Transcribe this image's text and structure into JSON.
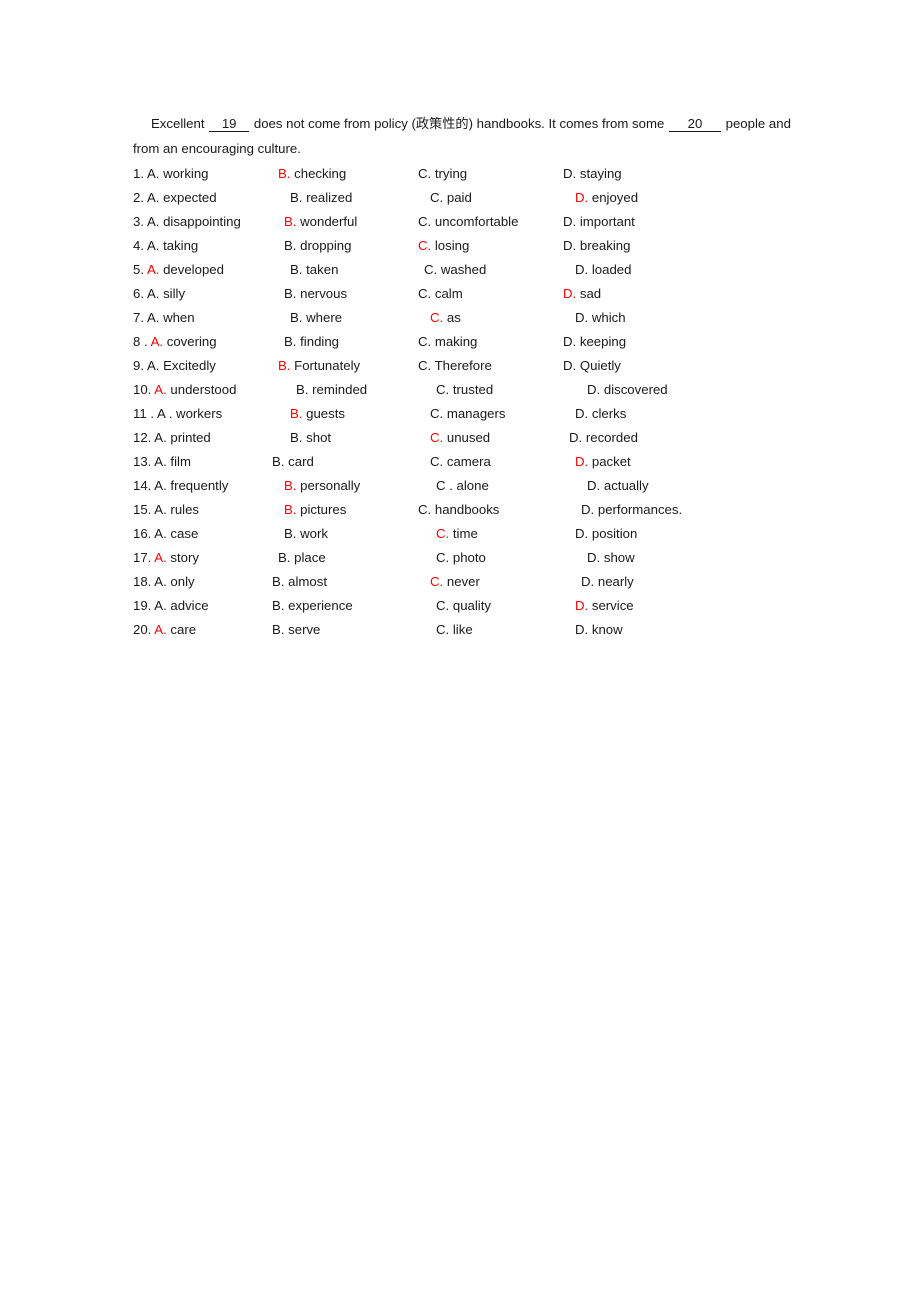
{
  "document": {
    "intro": {
      "line1_pre": "Excellent",
      "blank1": "19",
      "line1_mid": "does not come from policy (",
      "cjk_gloss": "政策性的",
      "line1_mid2": ") handbooks. It comes from some",
      "blank2": "20",
      "line1_post": "people and",
      "line2": "from an encouraging culture."
    },
    "colors": {
      "answer_red": "#FF0000",
      "text_black": "#1a1a1a",
      "page_background": "#ffffff"
    },
    "rows": [
      {
        "number": "1.",
        "options": [
          {
            "label": "A.",
            "text": "working",
            "red": false,
            "shift": "0"
          },
          {
            "label": "B.",
            "text": "checking",
            "red": true,
            "shift": "0"
          },
          {
            "label": "C.",
            "text": "trying",
            "red": false,
            "shift": "0"
          },
          {
            "label": "D.",
            "text": "staying",
            "red": false,
            "shift": "0"
          }
        ]
      },
      {
        "number": "2.",
        "options": [
          {
            "label": "A.",
            "text": "expected",
            "red": false,
            "shift": "0"
          },
          {
            "label": "B.",
            "text": "realized",
            "red": false,
            "shift": "2"
          },
          {
            "label": "C.",
            "text": "paid",
            "red": false,
            "shift": "2"
          },
          {
            "label": "D.",
            "text": "enjoyed",
            "red": true,
            "shift": "2"
          }
        ]
      },
      {
        "number": "3.",
        "options": [
          {
            "label": "A.",
            "text": "disappointing",
            "red": false,
            "shift": "0"
          },
          {
            "label": "B.",
            "text": "wonderful",
            "red": true,
            "shift": "1"
          },
          {
            "label": "C.",
            "text": "uncomfortable",
            "red": false,
            "shift": "0"
          },
          {
            "label": "D.",
            "text": "important",
            "red": false,
            "shift": "0"
          }
        ]
      },
      {
        "number": "4.",
        "options": [
          {
            "label": "A.",
            "text": "taking",
            "red": false,
            "shift": "0"
          },
          {
            "label": "B.",
            "text": "dropping",
            "red": false,
            "shift": "1"
          },
          {
            "label": "C.",
            "text": "losing",
            "red": true,
            "shift": "0"
          },
          {
            "label": "D.",
            "text": "breaking",
            "red": false,
            "shift": "0"
          }
        ]
      },
      {
        "number": "5.",
        "options": [
          {
            "label": "A.",
            "text": "developed",
            "red": true,
            "shift": "0"
          },
          {
            "label": "B.",
            "text": "taken",
            "red": false,
            "shift": "2"
          },
          {
            "label": "C.",
            "text": "washed",
            "red": false,
            "shift": "1"
          },
          {
            "label": "D.",
            "text": "loaded",
            "red": false,
            "shift": "2"
          }
        ]
      },
      {
        "number": "6.",
        "options": [
          {
            "label": "A.",
            "text": "silly",
            "red": false,
            "shift": "0"
          },
          {
            "label": "B.",
            "text": "nervous",
            "red": false,
            "shift": "1"
          },
          {
            "label": "C.",
            "text": "calm",
            "red": false,
            "shift": "0"
          },
          {
            "label": "D.",
            "text": "sad",
            "red": true,
            "shift": "0"
          }
        ]
      },
      {
        "number": "7.",
        "options": [
          {
            "label": "A.",
            "text": "when",
            "red": false,
            "shift": "0"
          },
          {
            "label": "B.",
            "text": "where",
            "red": false,
            "shift": "2"
          },
          {
            "label": "C.",
            "text": "as",
            "red": true,
            "shift": "2"
          },
          {
            "label": "D.",
            "text": "which",
            "red": false,
            "shift": "2"
          }
        ]
      },
      {
        "number": "8 .",
        "options": [
          {
            "label": "A.",
            "text": "covering",
            "red": true,
            "shift": "0"
          },
          {
            "label": "B.",
            "text": "finding",
            "red": false,
            "shift": "1"
          },
          {
            "label": "C.",
            "text": "making",
            "red": false,
            "shift": "0"
          },
          {
            "label": "D.",
            "text": "keeping",
            "red": false,
            "shift": "0"
          }
        ]
      },
      {
        "number": "9.",
        "options": [
          {
            "label": "A.",
            "text": "Excitedly",
            "red": false,
            "shift": "0"
          },
          {
            "label": "B.",
            "text": "Fortunately",
            "red": true,
            "shift": "0"
          },
          {
            "label": "C.",
            "text": "Therefore",
            "red": false,
            "shift": "0"
          },
          {
            "label": "D.",
            "text": "Quietly",
            "red": false,
            "shift": "0"
          }
        ]
      },
      {
        "number": "10.",
        "options": [
          {
            "label": "A.",
            "text": "understood",
            "red": true,
            "shift": "0"
          },
          {
            "label": "B.",
            "text": "reminded",
            "red": false,
            "shift": "3"
          },
          {
            "label": "C.",
            "text": "trusted",
            "red": false,
            "shift": "3"
          },
          {
            "label": "D.",
            "text": "discovered",
            "red": false,
            "shift": "4"
          }
        ]
      },
      {
        "number": "11 .",
        "options": [
          {
            "label": "A .",
            "text": "workers",
            "red": false,
            "shift": "0"
          },
          {
            "label": "B.",
            "text": "guests",
            "red": true,
            "shift": "2"
          },
          {
            "label": "C.",
            "text": "managers",
            "red": false,
            "shift": "2"
          },
          {
            "label": "D.",
            "text": "clerks",
            "red": false,
            "shift": "2"
          }
        ]
      },
      {
        "number": "12.",
        "options": [
          {
            "label": "A.",
            "text": "printed",
            "red": false,
            "shift": "0"
          },
          {
            "label": "B.",
            "text": "shot",
            "red": false,
            "shift": "2"
          },
          {
            "label": "C.",
            "text": "unused",
            "red": true,
            "shift": "2"
          },
          {
            "label": "D.",
            "text": "recorded",
            "red": false,
            "shift": "1"
          }
        ]
      },
      {
        "number": "13.",
        "options": [
          {
            "label": "A.",
            "text": "film",
            "red": false,
            "shift": "0"
          },
          {
            "label": "B.",
            "text": "card",
            "red": false,
            "shift": "-1"
          },
          {
            "label": "C.",
            "text": "camera",
            "red": false,
            "shift": "2"
          },
          {
            "label": "D.",
            "text": "packet",
            "red": true,
            "shift": "2"
          }
        ]
      },
      {
        "number": "14.",
        "options": [
          {
            "label": "A.",
            "text": "frequently",
            "red": false,
            "shift": "0"
          },
          {
            "label": "B.",
            "text": "personally",
            "red": true,
            "shift": "1"
          },
          {
            "label": "C .",
            "text": "alone",
            "red": false,
            "shift": "3"
          },
          {
            "label": "D.",
            "text": "actually",
            "red": false,
            "shift": "4"
          }
        ]
      },
      {
        "number": "15.",
        "options": [
          {
            "label": "A.",
            "text": "rules",
            "red": false,
            "shift": "0"
          },
          {
            "label": "B.",
            "text": "pictures",
            "red": true,
            "shift": "1"
          },
          {
            "label": "C.",
            "text": "handbooks",
            "red": false,
            "shift": "0"
          },
          {
            "label": "D.",
            "text": "performances.",
            "red": false,
            "shift": "3"
          }
        ]
      },
      {
        "number": "16.",
        "options": [
          {
            "label": "A.",
            "text": "case",
            "red": false,
            "shift": "0"
          },
          {
            "label": "B.",
            "text": "work",
            "red": false,
            "shift": "1"
          },
          {
            "label": "C.",
            "text": "time",
            "red": true,
            "shift": "3"
          },
          {
            "label": "D.",
            "text": "position",
            "red": false,
            "shift": "2"
          }
        ]
      },
      {
        "number": "17.",
        "options": [
          {
            "label": "A.",
            "text": "story",
            "red": true,
            "shift": "0"
          },
          {
            "label": "B.",
            "text": "place",
            "red": false,
            "shift": "0"
          },
          {
            "label": "C.",
            "text": "photo",
            "red": false,
            "shift": "3"
          },
          {
            "label": "D.",
            "text": "show",
            "red": false,
            "shift": "4"
          }
        ]
      },
      {
        "number": "18.",
        "options": [
          {
            "label": "A.",
            "text": "only",
            "red": false,
            "shift": "0"
          },
          {
            "label": "B.",
            "text": "almost",
            "red": false,
            "shift": "-1"
          },
          {
            "label": "C.",
            "text": "never",
            "red": true,
            "shift": "2"
          },
          {
            "label": "D.",
            "text": "nearly",
            "red": false,
            "shift": "3"
          }
        ]
      },
      {
        "number": "19.",
        "options": [
          {
            "label": "A.",
            "text": "advice",
            "red": false,
            "shift": "0"
          },
          {
            "label": "B.",
            "text": "experience",
            "red": false,
            "shift": "-1"
          },
          {
            "label": "C.",
            "text": "quality",
            "red": false,
            "shift": "3"
          },
          {
            "label": "D.",
            "text": "service",
            "red": true,
            "shift": "2"
          }
        ]
      },
      {
        "number": "20.",
        "options": [
          {
            "label": "A.",
            "text": "care",
            "red": true,
            "shift": "0"
          },
          {
            "label": "B.",
            "text": "serve",
            "red": false,
            "shift": "-1"
          },
          {
            "label": "C.",
            "text": "like",
            "red": false,
            "shift": "3"
          },
          {
            "label": "D.",
            "text": "know",
            "red": false,
            "shift": "2"
          }
        ]
      }
    ]
  }
}
